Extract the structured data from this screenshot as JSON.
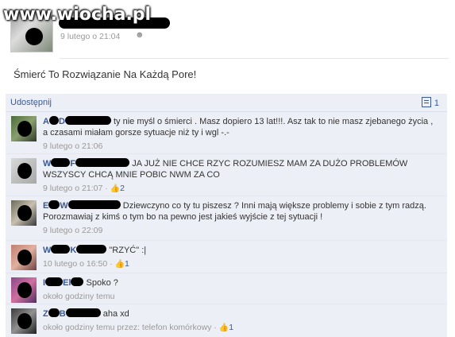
{
  "watermark": "www.wiocha.pl",
  "post": {
    "time": "9 lutego o 21:04",
    "status": "Śmierć To Rozwiązanie Na Każdą Pore!"
  },
  "share_bar": {
    "share_label": "Udostępnij",
    "comment_count": "1"
  },
  "comments": [
    {
      "name_visible": "A  D",
      "text": "ty nie myśl o śmierci . Masz dopiero 13 lat!!!. Asz tak to nie masz zjebanego życia , a czasami miałam gorsze sytuacje niż ty i wgl -.-",
      "time": "9 lutego o 21:06",
      "likes": ""
    },
    {
      "name_visible": "W  F",
      "text": "JA JUŻ NIE CHCE RZYC ROZUMIESZ MAM ZA DUŻO PROBLEMÓW WSZYSCY CHCĄ MNIE POBIC NWM ZA CO",
      "time": "9 lutego o 21:07",
      "likes": "2"
    },
    {
      "name_visible": "E  W",
      "text": "Dziewczyno co ty tu piszesz ? Inni mają większe problemy i sobie z tym radzą. Porozmawiaj z kimś o tym bo na pewno jest jakieś wyjście z tej sytuacji !",
      "time": "9 lutego o 22:09",
      "likes": ""
    },
    {
      "name_visible": "W  K",
      "text": "\"RZYĆ\" :|",
      "time": "10 lutego o 16:50",
      "likes": "1"
    },
    {
      "name_visible": "I  El",
      "text": "Spoko ?",
      "time": "około godziny temu",
      "likes": ""
    },
    {
      "name_visible": "Z  B",
      "text": "aha xd",
      "time": "około godziny temu przez: telefon komórkowy",
      "likes": "1"
    }
  ],
  "colors": {
    "link": "#3b5998",
    "comments_bg": "#eceff5",
    "meta": "#999999"
  },
  "icons": {
    "like": "thumbs-up-icon",
    "comment": "comment-icon",
    "audience": "friends-icon"
  }
}
